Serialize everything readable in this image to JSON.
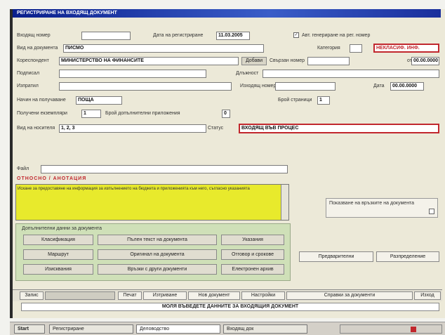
{
  "window": {
    "title": "РЕГИСТРИРАНЕ НА ВХОДЯЩ ДОКУМЕНТ"
  },
  "form": {
    "reg_no_label": "Входящ номер",
    "reg_no_value": "",
    "reg_date_label": "Дата на регистриране",
    "reg_date_value": "11.03.2005",
    "auto_number_label": "Авт. генериране на рег. номер",
    "auto_number_checked": true,
    "doc_type_label": "Вид на документа",
    "doc_type_value": "ПИСМО",
    "category_label": "Категория",
    "category_value": "",
    "secrecy_value": "НЕКЛАСИФ. ИНФ.",
    "correspondent_label": "Кореспондент",
    "correspondent_value": "МИНИСТЕРСТВО НА ФИНАНСИТЕ",
    "add_button": "Добави",
    "related_label": "Свързан номер",
    "related_value": "",
    "date_small_label": "от",
    "date_small_value": "00.00.0000",
    "signer_label": "Подписал",
    "signer_value": "",
    "position_label": "Длъжност",
    "position_value": "",
    "sender_label": "Изпратил",
    "sender_value": "",
    "outgoing_label": "Изходящ номер",
    "outgoing_value": "",
    "date_label": "Дата",
    "date_value": "00.00.0000",
    "delivery_label": "Начин на получаване",
    "delivery_value": "ПОЩА",
    "pages_label": "Брой страници",
    "pages_value": "1",
    "copies_label": "Получени екземпляри",
    "copies_value": "1",
    "attachments_label": "Брой допълнителни приложения",
    "attachments_value": "0",
    "attachment_pages_label": "Вид на носителя",
    "attachment_pages_value": "1, 2, 3",
    "status_label": "Статус",
    "status_value": "ВХОДЯЩ ВЪВ ПРОЦЕС",
    "file_label": "Файл",
    "file_value": "",
    "annotation_heading": "ОТНОСНО / АНОТАЦИЯ",
    "annotation_text": "Искане за предоставяне на информация за изпълнението на бюджета и приложенията към него, съгласно указанията",
    "links_checkbox_label": "Показване на връзките на документа",
    "links_checked": false
  },
  "actions": {
    "heading": "Допълнителни данни за документа",
    "buttons": [
      "Класификация",
      "Пълен текст на документа",
      "Указания",
      "Маршрут",
      "Оригинал на документа",
      "Отговор и срокове",
      "Изисквания",
      "Връзки с други документи",
      "Електронен архив"
    ],
    "next_button": "Предварителни",
    "forward_button": "Разпределение"
  },
  "bottombar": {
    "items": [
      "Запис",
      "",
      "Печат",
      "Изтриване",
      "Нов документ",
      "Настройки",
      "Справки за документи",
      "Изход"
    ]
  },
  "status": "МОЛЯ ВЪВЕДЕТЕ ДАННИТЕ ЗА ВХОДЯЩИЯ ДОКУМЕНТ",
  "taskbar": {
    "items": [
      "Start",
      "Регистриране",
      "Деловодство",
      "Входящ док"
    ]
  }
}
